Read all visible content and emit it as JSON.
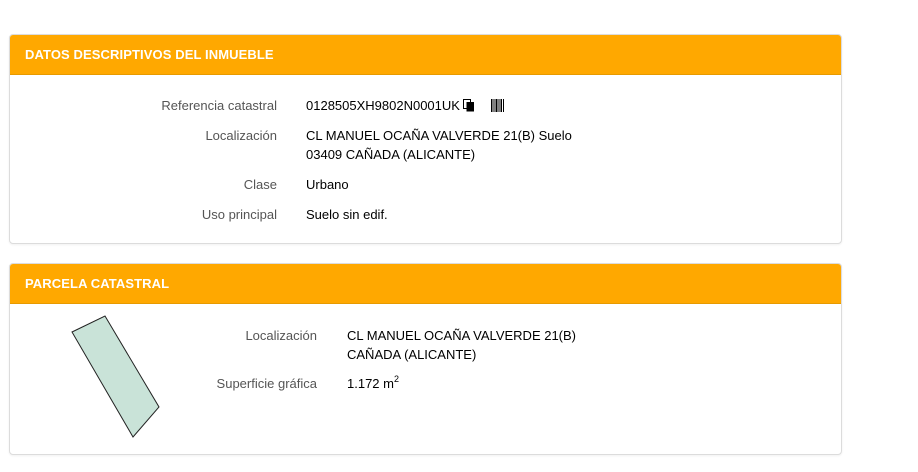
{
  "datos": {
    "title": "DATOS DESCRIPTIVOS DEL INMUEBLE",
    "referencia_label": "Referencia catastral",
    "referencia_value": "0128505XH9802N0001UK",
    "localizacion_label": "Localización",
    "localizacion_line1": "CL MANUEL OCAÑA VALVERDE 21(B) Suelo",
    "localizacion_line2": "03409 CAÑADA (ALICANTE)",
    "clase_label": "Clase",
    "clase_value": "Urbano",
    "uso_label": "Uso principal",
    "uso_value": "Suelo sin edif.",
    "icons": [
      "copy-icon",
      "barcode-icon"
    ]
  },
  "parcela": {
    "title": "PARCELA CATASTRAL",
    "localizacion_label": "Localización",
    "localizacion_line1": "CL MANUEL OCAÑA VALVERDE 21(B)",
    "localizacion_line2": "CAÑADA (ALICANTE)",
    "superficie_label": "Superficie gráfica",
    "superficie_value": "1.172 m",
    "superficie_unit_sup": "2"
  },
  "colors": {
    "header_bg": "#ffa800",
    "header_text": "#ffffff",
    "parcel_fill": "#c9e3d8",
    "parcel_stroke": "#222222"
  }
}
